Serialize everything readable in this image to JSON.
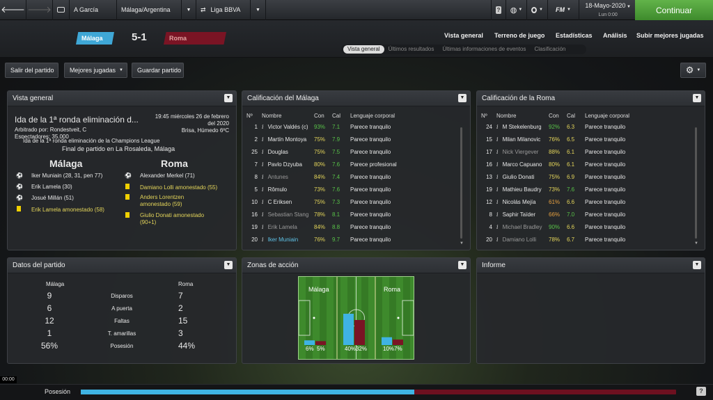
{
  "topbar": {
    "team": "A García",
    "competition": "Málaga/Argentina",
    "league": "Liga BBVA",
    "fm_label": "FM",
    "date": "18-Mayo-2020",
    "day": "Lun 0:00",
    "continue": "Continuar"
  },
  "match": {
    "home": "Málaga",
    "away": "Roma",
    "score": "5-1",
    "home_color": "#3fa7d6",
    "away_color": "#7a1424"
  },
  "nav": {
    "tabs": [
      "Vista general",
      "Terreno de juego",
      "Estadísticas",
      "Análisis",
      "Subir mejores jugadas"
    ],
    "subtabs": [
      "Vista general",
      "Últimos resultados",
      "Últimas informaciones de eventos",
      "Clasificación"
    ]
  },
  "toolbar": {
    "leave": "Salir del partido",
    "best": "Mejores jugadas",
    "save": "Guardar partido"
  },
  "overview": {
    "title": "Vista general",
    "headline": "Ida de la 1ª ronda eliminación d...",
    "datetime": "19:45 miércoles 26 de febrero del 2020",
    "referee": "Arbitrado por: Rondestveit, C",
    "weather": "Brisa, Húmedo 6ºC",
    "spectators": "Espectadores: 35.000",
    "competition": "Ida de la 1ª ronda eliminación de la Champions League",
    "result": "Final de partido en La Rosaleda, Málaga",
    "home": "Málaga",
    "away": "Roma",
    "home_events": [
      {
        "icon": "ball",
        "text": "Iker Muniain (28, 31, pen 77)"
      },
      {
        "icon": "ball",
        "text": "Erik Lamela (30)"
      },
      {
        "icon": "ball",
        "text": "Josué Millán (51)"
      },
      {
        "icon": "card",
        "text": "Erik Lamela amonestado (58)"
      }
    ],
    "away_events": [
      {
        "icon": "ball",
        "text": "Alexander Merkel (71)"
      },
      {
        "icon": "card",
        "text": "Damiano Lolli amonestado (55)"
      },
      {
        "icon": "card",
        "text": "Anders Lorentzen amonestado (59)"
      },
      {
        "icon": "card",
        "text": "Giulio Donati amonestado (90+1)"
      }
    ]
  },
  "ratings_home": {
    "title": "Calificación del Málaga",
    "headers": [
      "Nº",
      "Nombre",
      "Con",
      "Cal",
      "Lenguaje corporal"
    ],
    "rows": [
      [
        "1",
        "Victor Valdés (c)",
        "93%",
        "7.1",
        "Parece tranquilo"
      ],
      [
        "2",
        "Martín Montoya",
        "75%",
        "7.9",
        "Parece tranquilo"
      ],
      [
        "25",
        "Douglas",
        "75%",
        "7.5",
        "Parece tranquilo"
      ],
      [
        "7",
        "Pavlo Dzyuba",
        "80%",
        "7.6",
        "Parece profesional"
      ],
      [
        "8",
        "Antunes",
        "84%",
        "7.4",
        "Parece tranquilo"
      ],
      [
        "5",
        "Rômulo",
        "73%",
        "7.6",
        "Parece tranquilo"
      ],
      [
        "10",
        "C Eriksen",
        "75%",
        "7.3",
        "Parece tranquilo"
      ],
      [
        "16",
        "Sebastian Stang",
        "78%",
        "8.1",
        "Parece tranquilo"
      ],
      [
        "19",
        "Erik Lamela",
        "84%",
        "8.8",
        "Parece tranquilo"
      ],
      [
        "20",
        "Iker Muniain",
        "76%",
        "9.7",
        "Parece tranquilo"
      ]
    ]
  },
  "ratings_away": {
    "title": "Calificación de la Roma",
    "headers": [
      "Nº",
      "Nombre",
      "Con",
      "Cal",
      "Lenguaje corporal"
    ],
    "rows": [
      [
        "24",
        "M Stekelenburg",
        "92%",
        "6.3",
        "Parece tranquilo"
      ],
      [
        "15",
        "Milan Milanovic",
        "76%",
        "6.5",
        "Parece tranquilo"
      ],
      [
        "17",
        "Nick Viergever",
        "88%",
        "6.1",
        "Parece tranquilo"
      ],
      [
        "16",
        "Marco Capuano",
        "80%",
        "6.1",
        "Parece tranquilo"
      ],
      [
        "13",
        "Giulio Donati",
        "75%",
        "6.9",
        "Parece tranquilo"
      ],
      [
        "19",
        "Mathieu Baudry",
        "73%",
        "7.6",
        "Parece tranquilo"
      ],
      [
        "12",
        "Nicolás Mejía",
        "61%",
        "6.6",
        "Parece tranquilo"
      ],
      [
        "8",
        "Saphir Taïder",
        "66%",
        "7.0",
        "Parece tranquilo"
      ],
      [
        "4",
        "Michael Bradley",
        "90%",
        "6.6",
        "Parece tranquilo"
      ],
      [
        "20",
        "Damiano Lolli",
        "78%",
        "6.7",
        "Parece tranquilo"
      ]
    ]
  },
  "match_stats": {
    "title": "Datos del partido",
    "home": "Málaga",
    "away": "Roma",
    "rows": [
      [
        "9",
        "Disparos",
        "7"
      ],
      [
        "6",
        "A puerta",
        "2"
      ],
      [
        "12",
        "Faltas",
        "15"
      ],
      [
        "1",
        "T. amarillas",
        "3"
      ],
      [
        "56%",
        "Posesión",
        "44%"
      ]
    ]
  },
  "action_zones": {
    "title": "Zonas de acción",
    "home": "Málaga",
    "away": "Roma",
    "zones": [
      {
        "home": 6,
        "away": 5,
        "home_label": "6%",
        "away_label": "5%"
      },
      {
        "home": 40,
        "away": 32,
        "home_label": "40%",
        "away_label": "32%"
      },
      {
        "home": 10,
        "away": 7,
        "home_label": "10%",
        "away_label": "7%"
      }
    ]
  },
  "report": {
    "title": "Informe"
  },
  "bottom": {
    "time": "00:00",
    "possession_label": "Posesión",
    "possession_home": 56
  }
}
